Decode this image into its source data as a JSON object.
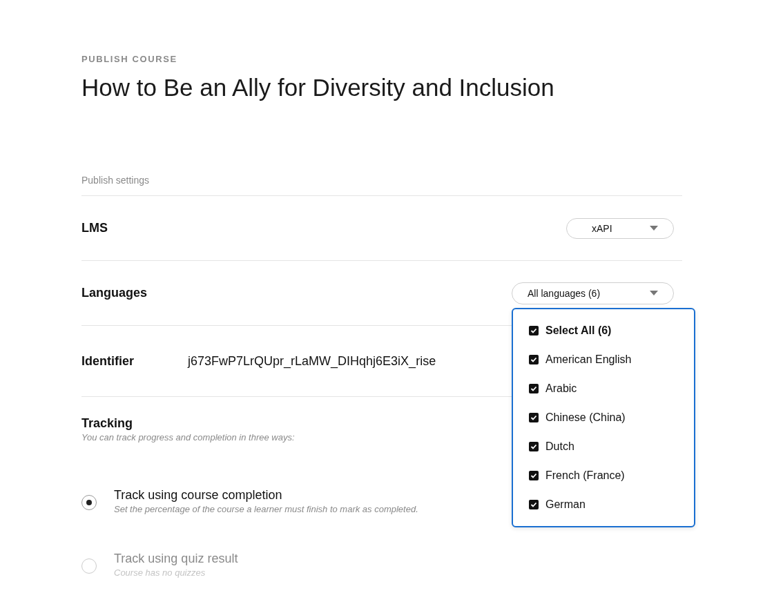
{
  "header": {
    "eyebrow": "PUBLISH COURSE",
    "title": "How to Be an Ally for Diversity and Inclusion"
  },
  "section_label": "Publish settings",
  "lms": {
    "label": "LMS",
    "value": "xAPI"
  },
  "languages": {
    "label": "Languages",
    "value": "All languages (6)",
    "expanded": true,
    "options": [
      {
        "kind": "select_all",
        "label": "Select All (6)",
        "checked": true
      },
      {
        "kind": "language",
        "label": "American English",
        "checked": true
      },
      {
        "kind": "language",
        "label": "Arabic",
        "checked": true
      },
      {
        "kind": "language",
        "label": "Chinese (China)",
        "checked": true
      },
      {
        "kind": "language",
        "label": "Dutch",
        "checked": true
      },
      {
        "kind": "language",
        "label": "French (France)",
        "checked": true
      },
      {
        "kind": "language",
        "label": "German",
        "checked": true
      }
    ]
  },
  "identifier": {
    "label": "Identifier",
    "value": "j673FwP7LrQUpr_rLaMW_DIHqhj6E3iX_rise"
  },
  "tracking": {
    "title": "Tracking",
    "subtitle": "You can track progress and completion in three ways:",
    "options": [
      {
        "label": "Track using course completion",
        "description": "Set the percentage of the course a learner must finish to mark as completed.",
        "selected": true,
        "disabled": false
      },
      {
        "label": "Track using quiz result",
        "description": "Course has no quizzes",
        "selected": false,
        "disabled": true
      }
    ]
  }
}
